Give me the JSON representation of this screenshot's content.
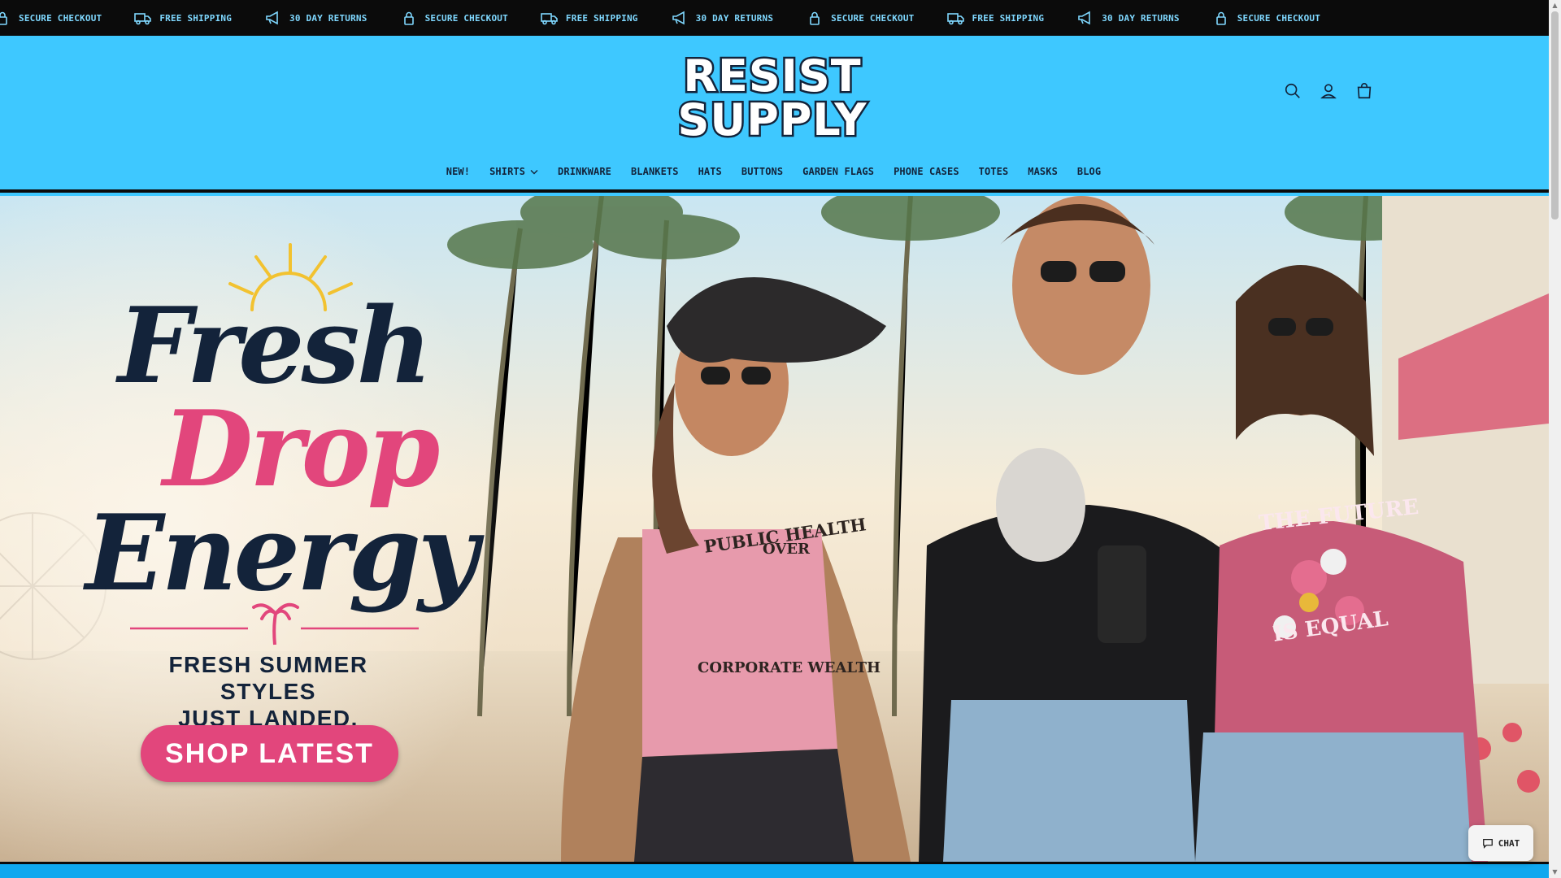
{
  "announcement": {
    "items": [
      {
        "label": "SECURE CHECKOUT",
        "icon": "lock-icon"
      },
      {
        "label": "FREE SHIPPING",
        "icon": "truck-icon"
      },
      {
        "label": "30 DAY RETURNS",
        "icon": "megaphone-icon"
      },
      {
        "label": "SECURE CHECKOUT",
        "icon": "lock-icon"
      },
      {
        "label": "FREE SHIPPING",
        "icon": "truck-icon"
      },
      {
        "label": "30 DAY RETURNS",
        "icon": "megaphone-icon"
      },
      {
        "label": "SECURE CHECKOUT",
        "icon": "lock-icon"
      },
      {
        "label": "FREE SHIPPING",
        "icon": "truck-icon"
      },
      {
        "label": "30 DAY RETURNS",
        "icon": "megaphone-icon"
      },
      {
        "label": "SECURE CHECKOUT",
        "icon": "lock-icon"
      }
    ]
  },
  "brand": {
    "line1": "RESIST",
    "line2": "SUPPLY"
  },
  "header_icons": [
    "search-icon",
    "account-icon",
    "cart-icon"
  ],
  "nav": {
    "items": [
      {
        "label": "NEW!",
        "has_dropdown": false
      },
      {
        "label": "SHIRTS",
        "has_dropdown": true
      },
      {
        "label": "DRINKWARE",
        "has_dropdown": false
      },
      {
        "label": "BLANKETS",
        "has_dropdown": false
      },
      {
        "label": "HATS",
        "has_dropdown": false
      },
      {
        "label": "BUTTONS",
        "has_dropdown": false
      },
      {
        "label": "GARDEN FLAGS",
        "has_dropdown": false
      },
      {
        "label": "PHONE CASES",
        "has_dropdown": false
      },
      {
        "label": "TOTES",
        "has_dropdown": false
      },
      {
        "label": "MASKS",
        "has_dropdown": false
      },
      {
        "label": "BLOG",
        "has_dropdown": false
      }
    ]
  },
  "hero": {
    "headline_1": "Fresh",
    "headline_2": "Drop",
    "headline_3": "Energy",
    "sub_1": "FRESH SUMMER STYLES",
    "sub_2": "JUST LANDED.",
    "cta": "SHOP LATEST",
    "shirt_1_top": "PUBLIC HEALTH",
    "shirt_1_mid": "OVER",
    "shirt_1_bottom": "CORPORATE WEALTH",
    "shirt_3_top": "THE FUTURE",
    "shirt_3_bottom": "IS EQUAL"
  },
  "chat": {
    "label": "CHAT"
  },
  "colors": {
    "header_bg": "#3ec8ff",
    "announce_bg": "#0b0b0b",
    "announce_text": "#7fd8ff",
    "navy": "#13233a",
    "pink": "#e2467c"
  }
}
